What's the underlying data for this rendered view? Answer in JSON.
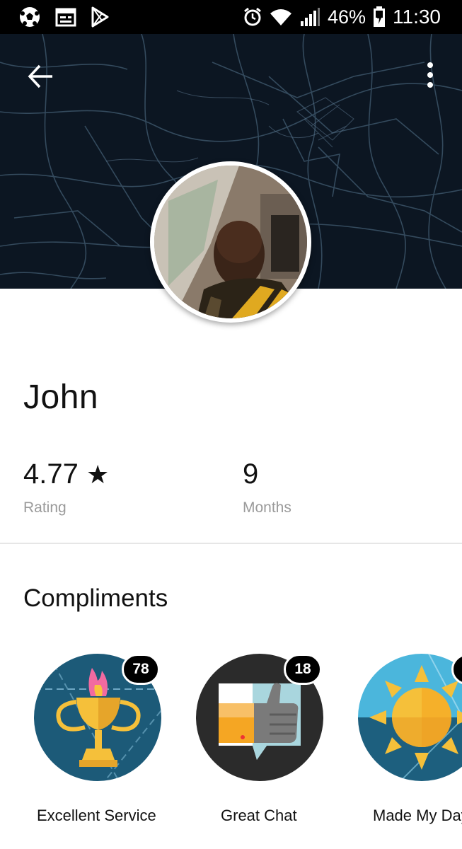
{
  "status_bar": {
    "battery": "46%",
    "time": "11:30",
    "icons": [
      "soccer-ball-icon",
      "calendar-icon",
      "play-store-icon",
      "alarm-icon",
      "wifi-icon",
      "signal-icon",
      "battery-icon"
    ]
  },
  "header": {
    "back_icon": "back-arrow-icon",
    "menu_icon": "more-vert-icon"
  },
  "profile": {
    "name": "John",
    "rating_value": "4.77",
    "rating_star": "★",
    "rating_label": "Rating",
    "months_value": "9",
    "months_label": "Months"
  },
  "compliments": {
    "title": "Compliments",
    "items": [
      {
        "label": "Excellent Service",
        "count": "78",
        "icon": "trophy-icon"
      },
      {
        "label": "Great Chat",
        "count": "18",
        "icon": "thumbs-up-icon"
      },
      {
        "label": "Made My Day",
        "count": "",
        "icon": "sun-icon"
      }
    ]
  },
  "colors": {
    "hero_bg": "#0c1622",
    "map_roads": "#3b5468",
    "status_bar": "#000000",
    "label_gray": "#9a9a9a"
  }
}
